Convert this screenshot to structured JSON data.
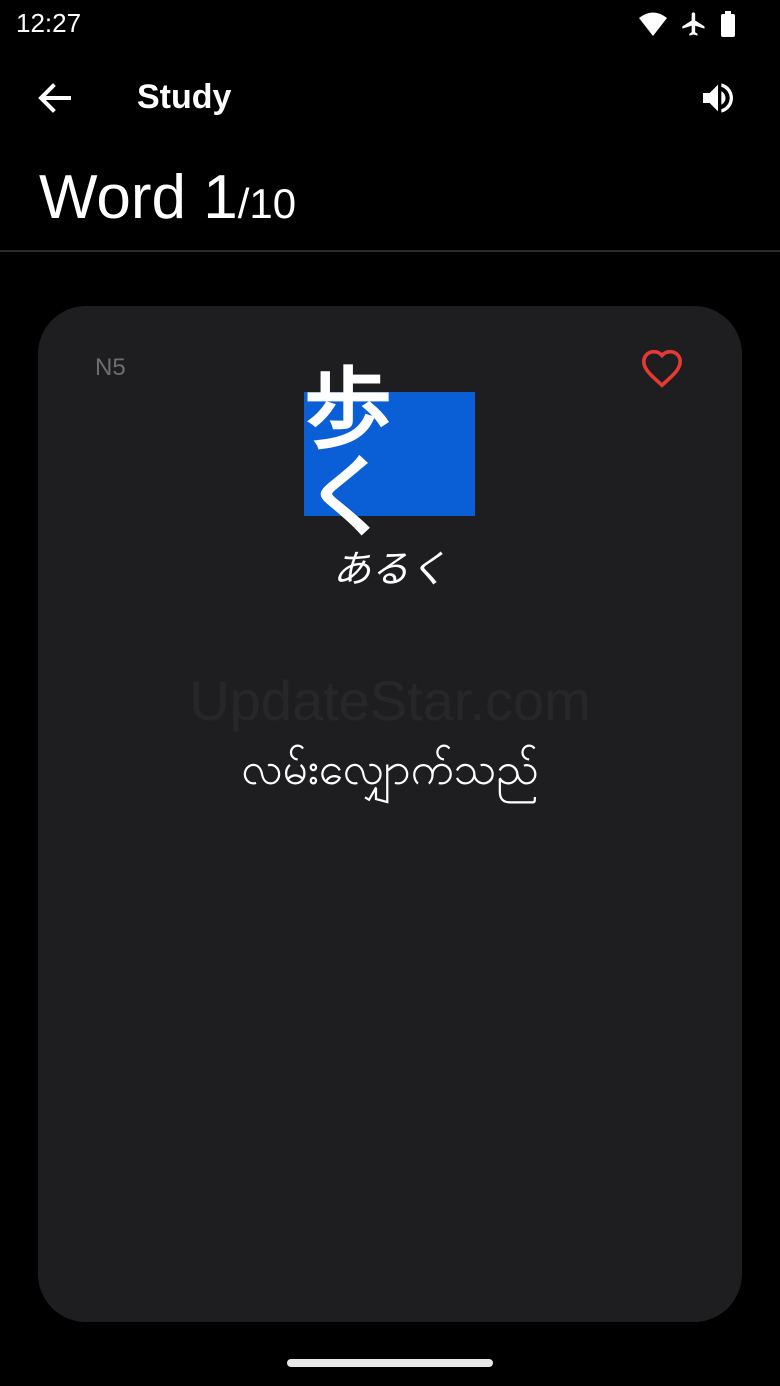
{
  "status_bar": {
    "time": "12:27",
    "icons": [
      "wifi-icon",
      "airplane-icon",
      "battery-icon"
    ]
  },
  "app_bar": {
    "title": "Study",
    "back_icon": "arrow-left-icon",
    "speaker_icon": "speaker-icon"
  },
  "counter": {
    "label": "Word 1",
    "total": "/10"
  },
  "card": {
    "level": "N5",
    "favorite_icon": "heart-outline-icon",
    "kanji": "歩く",
    "reading": "あるく",
    "meaning": "လမ်းလျှောက်သည်",
    "watermark": "UpdateStar.com"
  },
  "colors": {
    "background": "#000000",
    "card": "#1e1e20",
    "kanji_highlight": "#0a5fd6",
    "favorite": "#e53935",
    "level_text": "#6e6e6e"
  }
}
